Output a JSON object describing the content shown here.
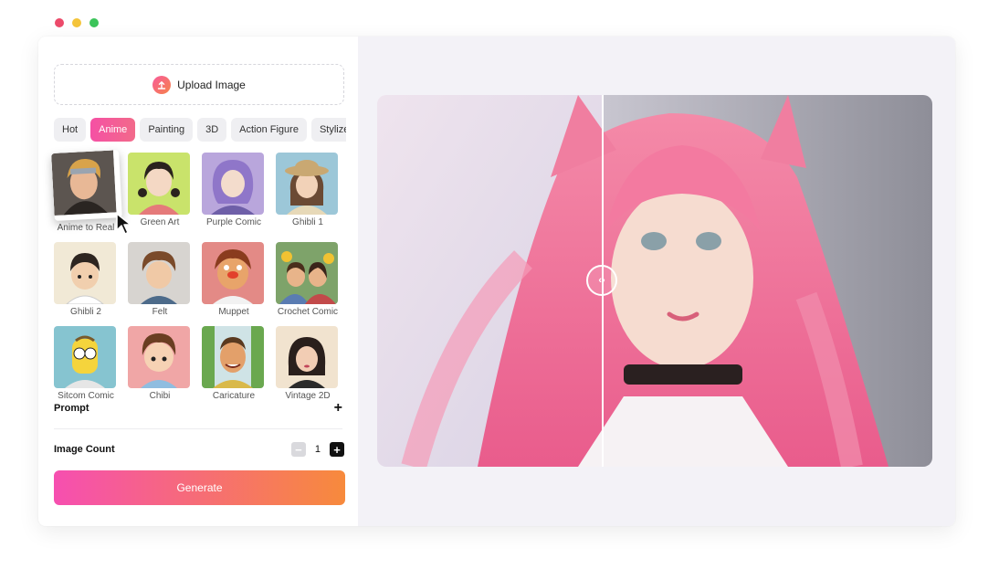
{
  "window": {
    "traffic_lights": [
      "#ec4a6a",
      "#f4c43a",
      "#3cc45a"
    ]
  },
  "upload": {
    "label": "Upload Image",
    "icon": "upload-icon"
  },
  "tabs": [
    {
      "label": "Hot"
    },
    {
      "label": "Anime",
      "active": true
    },
    {
      "label": "Painting"
    },
    {
      "label": "3D"
    },
    {
      "label": "Action Figure"
    },
    {
      "label": "Stylize"
    }
  ],
  "styles": [
    {
      "label": "Anime to Real",
      "selected": true
    },
    {
      "label": "Green Art"
    },
    {
      "label": "Purple Comic"
    },
    {
      "label": "Ghibli 1"
    },
    {
      "label": "Ghibli 2"
    },
    {
      "label": "Felt"
    },
    {
      "label": "Muppet"
    },
    {
      "label": "Crochet Comic"
    },
    {
      "label": "Sitcom Comic"
    },
    {
      "label": "Chibi"
    },
    {
      "label": "Caricature"
    },
    {
      "label": "Vintage 2D"
    }
  ],
  "prompt": {
    "label": "Prompt",
    "expand": "+"
  },
  "image_count": {
    "label": "Image Count",
    "value": "1",
    "minus": "−",
    "plus": "+"
  },
  "generate": {
    "label": "Generate"
  },
  "preview": {
    "divider_handle": "‹›"
  },
  "colors": {
    "accent_start": "#f64fb0",
    "accent_end": "#f78a3c"
  }
}
